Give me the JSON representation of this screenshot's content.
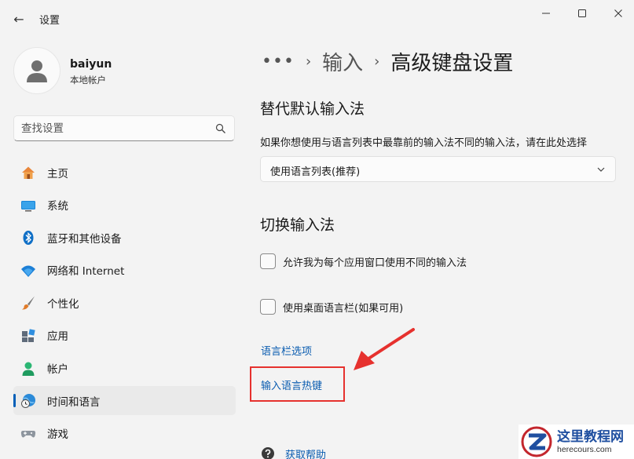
{
  "window": {
    "title": "设置",
    "back": "←",
    "minimize": "─",
    "maximize": "☐",
    "close": "✕"
  },
  "user": {
    "name": "baiyun",
    "account_type": "本地帐户"
  },
  "search": {
    "placeholder": "查找设置"
  },
  "sidebar": {
    "items": [
      {
        "label": "主页",
        "icon": "home-icon",
        "active": false
      },
      {
        "label": "系统",
        "icon": "system-icon",
        "active": false
      },
      {
        "label": "蓝牙和其他设备",
        "icon": "bluetooth-icon",
        "active": false
      },
      {
        "label": "网络和 Internet",
        "icon": "wifi-icon",
        "active": false
      },
      {
        "label": "个性化",
        "icon": "brush-icon",
        "active": false
      },
      {
        "label": "应用",
        "icon": "apps-icon",
        "active": false
      },
      {
        "label": "帐户",
        "icon": "account-icon",
        "active": false
      },
      {
        "label": "时间和语言",
        "icon": "time-language-icon",
        "active": true
      },
      {
        "label": "游戏",
        "icon": "gamepad-icon",
        "active": false
      }
    ]
  },
  "breadcrumb": {
    "more": "•••",
    "separator": "›",
    "parent": "输入",
    "current": "高级键盘设置"
  },
  "override": {
    "title": "替代默认输入法",
    "description": "如果你想使用与语言列表中最靠前的输入法不同的输入法，请在此处选择",
    "dropdown_value": "使用语言列表(推荐)"
  },
  "switching": {
    "title": "切换输入法",
    "checkbox_per_app": "允许我为每个应用窗口使用不同的输入法",
    "checkbox_desktop_bar": "使用桌面语言栏(如果可用)",
    "link_language_bar": "语言栏选项",
    "link_hotkeys": "输入语言热键"
  },
  "help": {
    "label": "获取帮助"
  },
  "watermark": {
    "title": "这里教程网",
    "url": "herecours.com"
  },
  "colors": {
    "accent": "#005fb8",
    "link": "#0a5cb0",
    "annotation_red": "#e6312e"
  }
}
